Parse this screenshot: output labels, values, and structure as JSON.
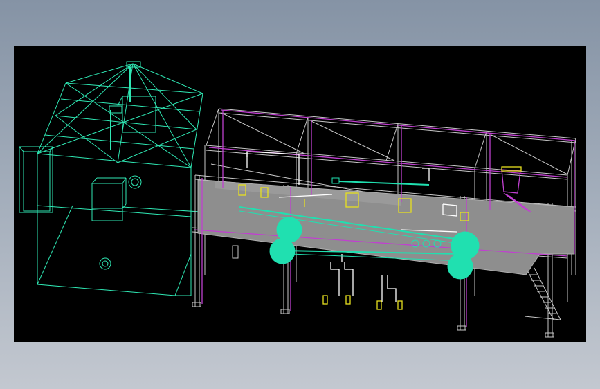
{
  "viewer": {
    "background": "#000000",
    "frame_color": "#8a96a8"
  },
  "model": {
    "colors": {
      "building_wire": "#2fe8b4",
      "steel_frame": "#d0d0d0",
      "accent_beam": "#c040d0",
      "platform_fill": "#8e8e8e",
      "white_parts": "#ffffff",
      "yellow_parts": "#e8e020",
      "cyan_rollers": "#20e0b0"
    }
  }
}
